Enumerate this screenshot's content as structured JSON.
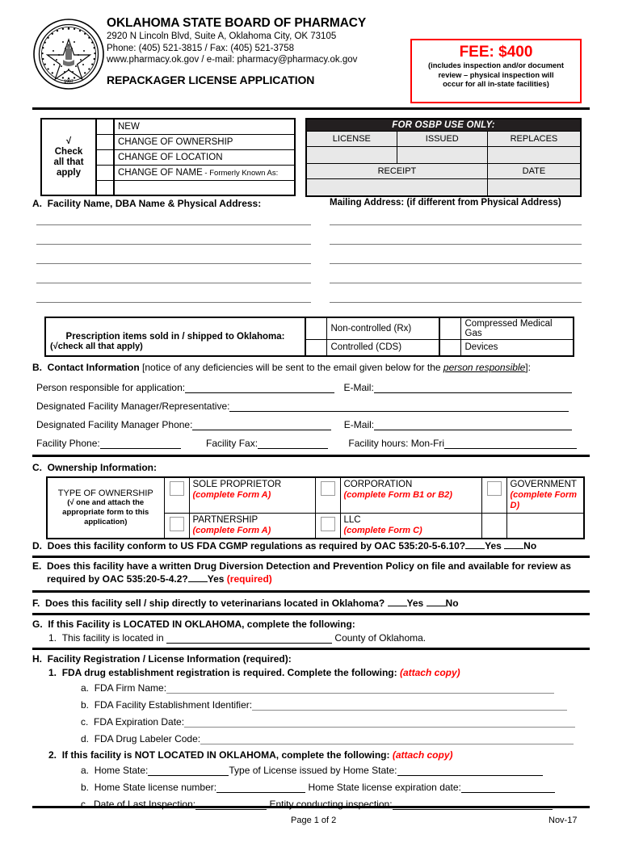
{
  "header": {
    "org_name": "OKLAHOMA STATE BOARD OF PHARMACY",
    "address": "2920 N Lincoln Blvd, Suite A, Oklahoma City, OK  73105",
    "phone": "Phone: (405) 521-3815 / Fax: (405) 521-3758",
    "web": "www.pharmacy.ok.gov  /  e-mail:  pharmacy@pharmacy.ok.gov",
    "form_title": "REPACKAGER LICENSE APPLICATION",
    "seal_outer_text": "GREAT SEAL OF THE STATE OF OKLAHOMA",
    "seal_year": "1907"
  },
  "fee_box": {
    "title": "FEE: $400",
    "note_line1": "(includes inspection and/or document",
    "note_line2": "review  – physical inspection will",
    "note_line3": "occur for all in-state facilities)",
    "border_color": "#ff0000",
    "text_color": "#ff0000"
  },
  "check_table": {
    "instruction_check": "√",
    "instruction_line1": "Check",
    "instruction_line2": "all that",
    "instruction_line3": "apply",
    "options": [
      {
        "label": "NEW",
        "suffix": ""
      },
      {
        "label": "CHANGE OF OWNERSHIP",
        "suffix": ""
      },
      {
        "label": "CHANGE OF LOCATION",
        "suffix": ""
      },
      {
        "label": "CHANGE OF NAME",
        "suffix": " - Formerly Known As:"
      }
    ]
  },
  "osbp": {
    "title": "FOR OSBP USE ONLY:",
    "row1_headers": [
      "LICENSE",
      "ISSUED",
      "REPLACES"
    ],
    "row2_headers": [
      "RECEIPT",
      "DATE"
    ]
  },
  "section_a": {
    "letter": "A.",
    "left_title": "Facility Name, DBA Name & Physical Address:",
    "right_title": "Mailing Address: (if different from Physical Address)",
    "line_count": 5
  },
  "rx_box": {
    "label_line1": "Prescription items sold in / shipped to Oklahoma:",
    "label_line2": "(√check all that apply)",
    "items": [
      "Non-controlled (Rx)",
      "Compressed Medical Gas",
      "Controlled (CDS)",
      "Devices"
    ]
  },
  "section_b": {
    "letter": "B.",
    "title": "Contact Information",
    "note_pre": " [notice of any deficiencies will be sent to the email given below for the ",
    "note_em": "person responsible",
    "note_post": "]:",
    "f_person": "Person responsible for application:",
    "f_email1": "E-Mail:",
    "f_mgr": "Designated Facility Manager/Representative:",
    "f_mgr_phone": "Designated Facility Manager Phone:",
    "f_email2": "E-Mail:",
    "f_phone": "Facility Phone:",
    "f_fax": "Facility Fax:",
    "f_hours": "Facility hours: Mon-Fri"
  },
  "section_c": {
    "letter": "C.",
    "title": "Ownership Information:",
    "type_label_line1": "TYPE OF OWNERSHIP",
    "type_label_line2": "(√ one and attach the",
    "type_label_line3": "appropriate form to this",
    "type_label_line4": "application)",
    "options": [
      {
        "name": "SOLE PROPRIETOR",
        "form": "(complete Form A)"
      },
      {
        "name": "CORPORATION",
        "form": "(complete Form B1 or B2)"
      },
      {
        "name": "GOVERNMENT",
        "form": "(complete Form D)"
      },
      {
        "name": "PARTNERSHIP",
        "form": "(complete Form A)"
      },
      {
        "name": "LLC",
        "form": "(complete Form C)"
      }
    ]
  },
  "section_d": {
    "letter": "D.",
    "text": "Does this facility conform to US FDA CGMP regulations as required by OAC 535:20-5-6.10?",
    "yes": "Yes",
    "no": "No"
  },
  "section_e": {
    "letter": "E.",
    "line1": "Does this facility have a written Drug Diversion Detection and Prevention Policy on file and available for review as",
    "line2": "required by OAC 535:20-5-4.2?",
    "yes": "Yes",
    "required": "(required)"
  },
  "section_f": {
    "letter": "F.",
    "text": "Does this facility sell / ship directly to veterinarians located in Oklahoma?",
    "yes": "Yes",
    "no": "No"
  },
  "section_g": {
    "letter": "G.",
    "title": "If this Facility is LOCATED IN OKLAHOMA, complete the following:",
    "item_num": "1.",
    "item_pre": "This facility is located in",
    "item_post": "County of Oklahoma."
  },
  "section_h": {
    "letter": "H.",
    "title": "Facility Registration / License Information (required):",
    "sub1_num": "1.",
    "sub1_text": "FDA drug establishment registration is required.  Complete the following:",
    "sub1_attach": "(attach copy)",
    "sub1_items": [
      {
        "bullet": "a.",
        "label": "FDA Firm Name:"
      },
      {
        "bullet": "b.",
        "label": "FDA Facility Establishment Identifier:"
      },
      {
        "bullet": "c.",
        "label": "FDA Expiration Date:"
      },
      {
        "bullet": "d.",
        "label": "FDA Drug Labeler Code:"
      }
    ],
    "sub2_num": "2.",
    "sub2_text": "If this facility is NOT LOCATED IN OKLAHOMA, complete the following:",
    "sub2_attach": "(attach copy)",
    "sub2_items": [
      {
        "bullet": "a.",
        "label1": "Home State:",
        "label2": "Type of License issued by Home State:"
      },
      {
        "bullet": "b.",
        "label1": "Home State license number:",
        "label2": "Home State license expiration date:"
      },
      {
        "bullet": "c.",
        "label1": "Date of Last Inspection:",
        "label2": "Entity conducting inspection:"
      }
    ]
  },
  "footer": {
    "page": "Page 1 of 2",
    "revision": "Nov-17"
  }
}
